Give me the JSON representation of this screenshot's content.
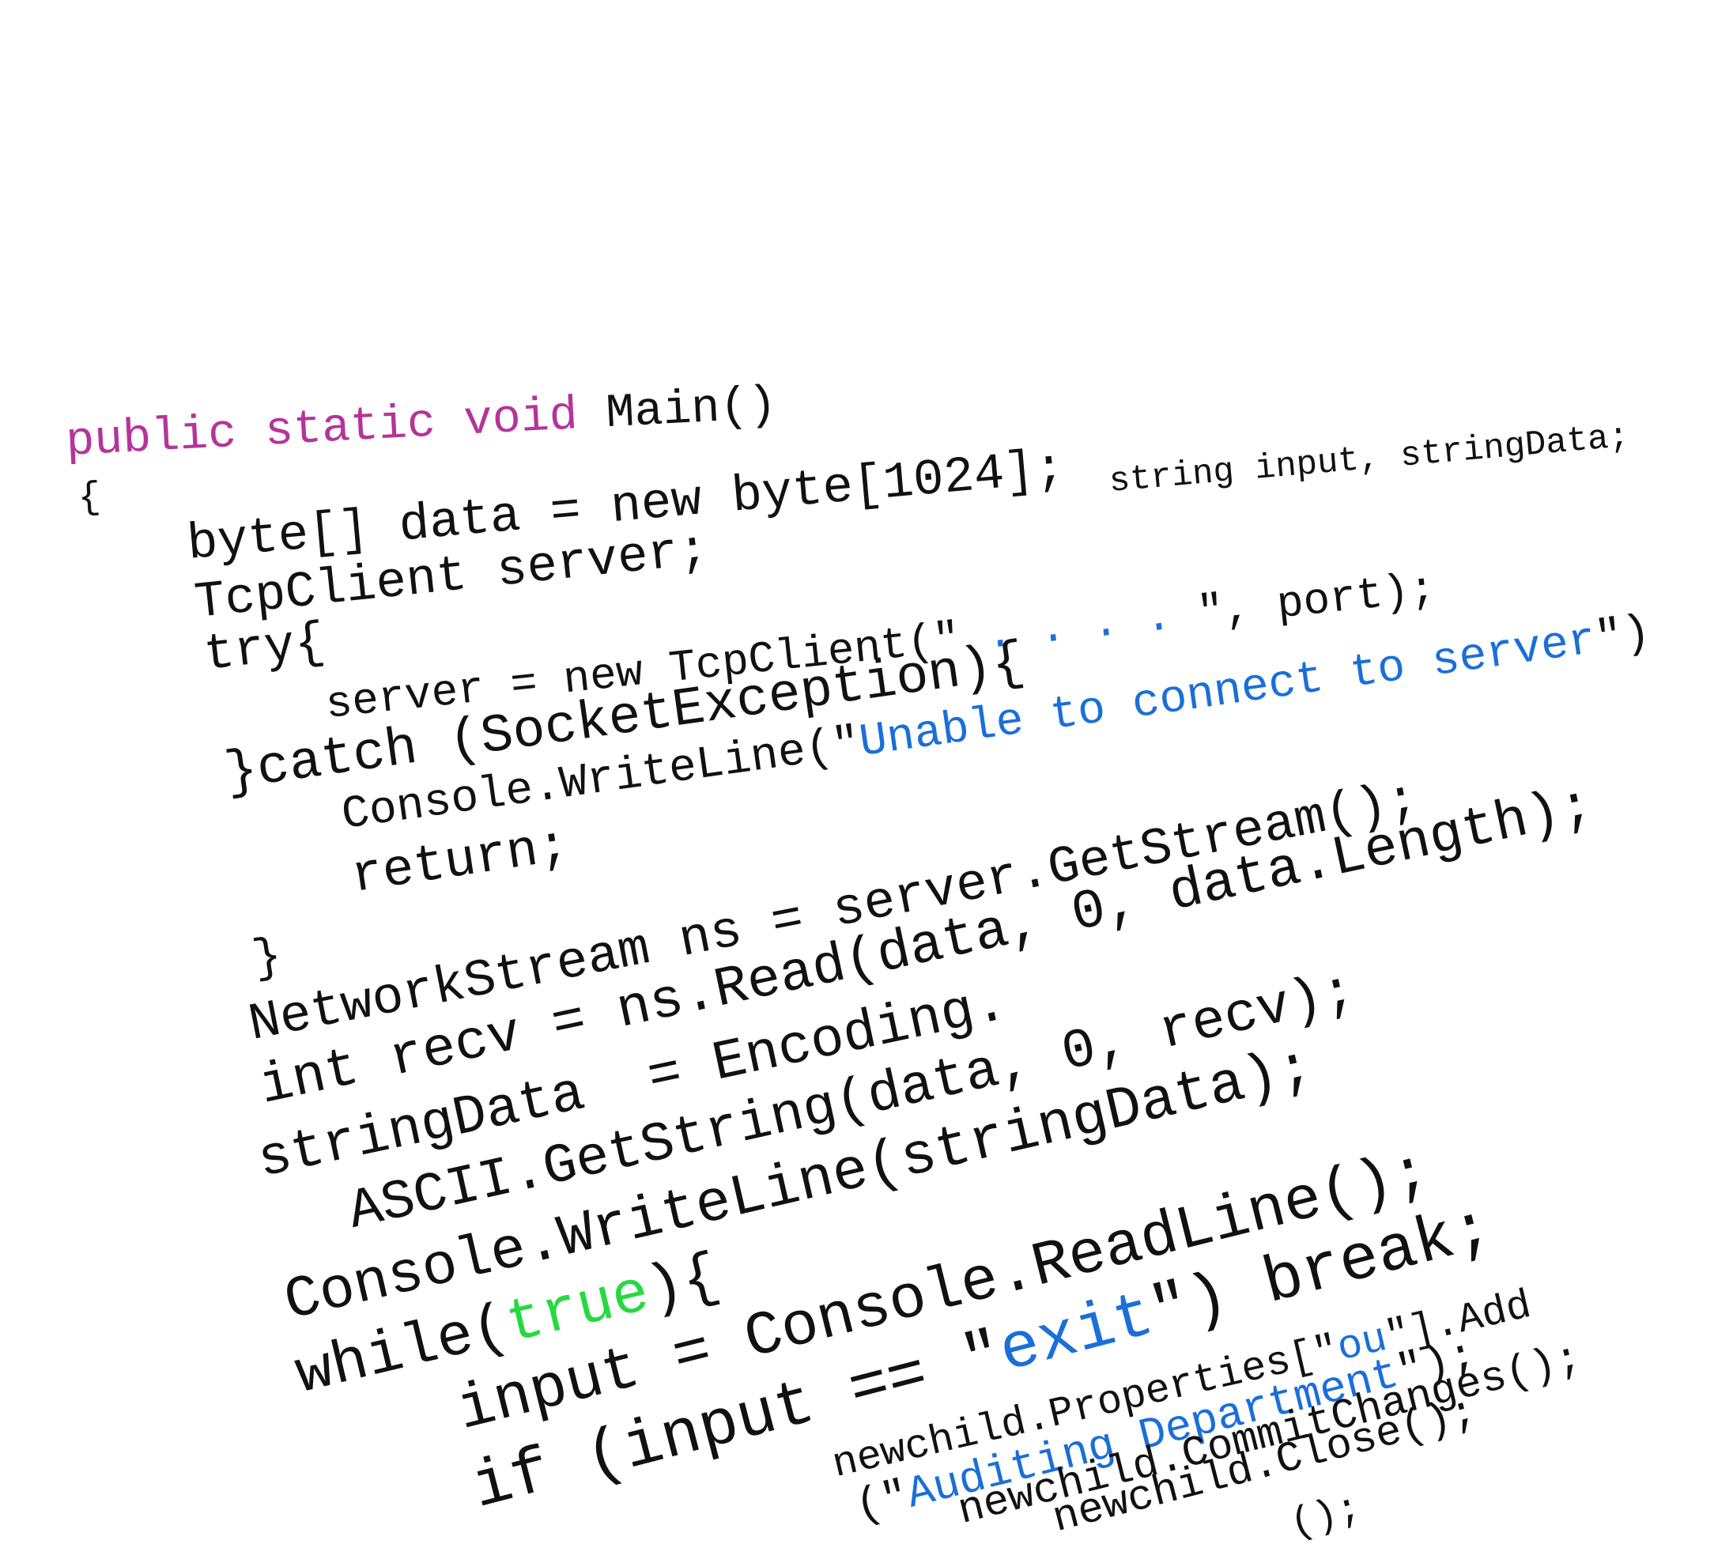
{
  "colors": {
    "text": "#111111",
    "keyword": "#b5349a",
    "string": "#1a6fd8",
    "boolean": "#26d940",
    "background": "#ffffff"
  },
  "code_lines": [
    {
      "tokens": [
        {
          "text": "public static void ",
          "kind": "keyword"
        },
        {
          "text": "Main()",
          "kind": "text"
        }
      ]
    },
    {
      "tokens": [
        {
          "text": "{",
          "kind": "text"
        }
      ]
    },
    {
      "tokens": [
        {
          "text": "byte[] data = new byte[1024];",
          "kind": "text"
        }
      ]
    },
    {
      "tokens": [
        {
          "text": "string input, stringData;",
          "kind": "text"
        }
      ]
    },
    {
      "tokens": [
        {
          "text": "TcpClient server;",
          "kind": "text"
        }
      ]
    },
    {
      "tokens": [
        {
          "text": "try{",
          "kind": "text"
        }
      ]
    },
    {
      "tokens": [
        {
          "text": "server = new TcpClient(\" ",
          "kind": "text"
        },
        {
          "text": ". . . .",
          "kind": "string"
        },
        {
          "text": " \", port);",
          "kind": "text"
        }
      ]
    },
    {
      "tokens": [
        {
          "text": "}catch (SocketException){",
          "kind": "text"
        }
      ]
    },
    {
      "tokens": [
        {
          "text": "Console.WriteLine(\"",
          "kind": "text"
        },
        {
          "text": "Unable to connect to server",
          "kind": "string"
        },
        {
          "text": "\")",
          "kind": "text"
        }
      ]
    },
    {
      "tokens": [
        {
          "text": "return;",
          "kind": "text"
        }
      ]
    },
    {
      "tokens": [
        {
          "text": "}",
          "kind": "text"
        }
      ]
    },
    {
      "tokens": [
        {
          "text": "NetworkStream ns = server.GetStream();",
          "kind": "text"
        }
      ]
    },
    {
      "tokens": [
        {
          "text": "int recv = ns.Read(data, 0, data.Length);",
          "kind": "text"
        }
      ]
    },
    {
      "tokens": [
        {
          "text": "stringData  = Encoding.",
          "kind": "text"
        }
      ]
    },
    {
      "tokens": [
        {
          "text": "ASCII.GetString(data, 0, recv);",
          "kind": "text"
        }
      ]
    },
    {
      "tokens": [
        {
          "text": "Console.WriteLine(stringData);",
          "kind": "text"
        }
      ]
    },
    {
      "tokens": [
        {
          "text": "while(",
          "kind": "text"
        },
        {
          "text": "true",
          "kind": "boolean"
        },
        {
          "text": "){",
          "kind": "text"
        }
      ]
    },
    {
      "tokens": [
        {
          "text": "input = Console.ReadLine();",
          "kind": "text"
        }
      ]
    },
    {
      "tokens": [
        {
          "text": "if (input == \"",
          "kind": "text"
        },
        {
          "text": "exit",
          "kind": "string"
        },
        {
          "text": "\") break;",
          "kind": "text"
        }
      ]
    },
    {
      "tokens": [
        {
          "text": "newchild.Properties[\"",
          "kind": "text"
        },
        {
          "text": "ou",
          "kind": "string"
        },
        {
          "text": "\"].Add",
          "kind": "text"
        }
      ]
    },
    {
      "tokens": [
        {
          "text": "(\"",
          "kind": "text"
        },
        {
          "text": "Auditing Department",
          "kind": "string"
        },
        {
          "text": "\");",
          "kind": "text"
        }
      ]
    },
    {
      "tokens": [
        {
          "text": "newchild.CommitChanges();",
          "kind": "text"
        }
      ]
    },
    {
      "tokens": [
        {
          "text": "newchild.Close();",
          "kind": "text"
        }
      ]
    },
    {
      "tokens": [
        {
          "text": "();",
          "kind": "text"
        }
      ]
    }
  ]
}
